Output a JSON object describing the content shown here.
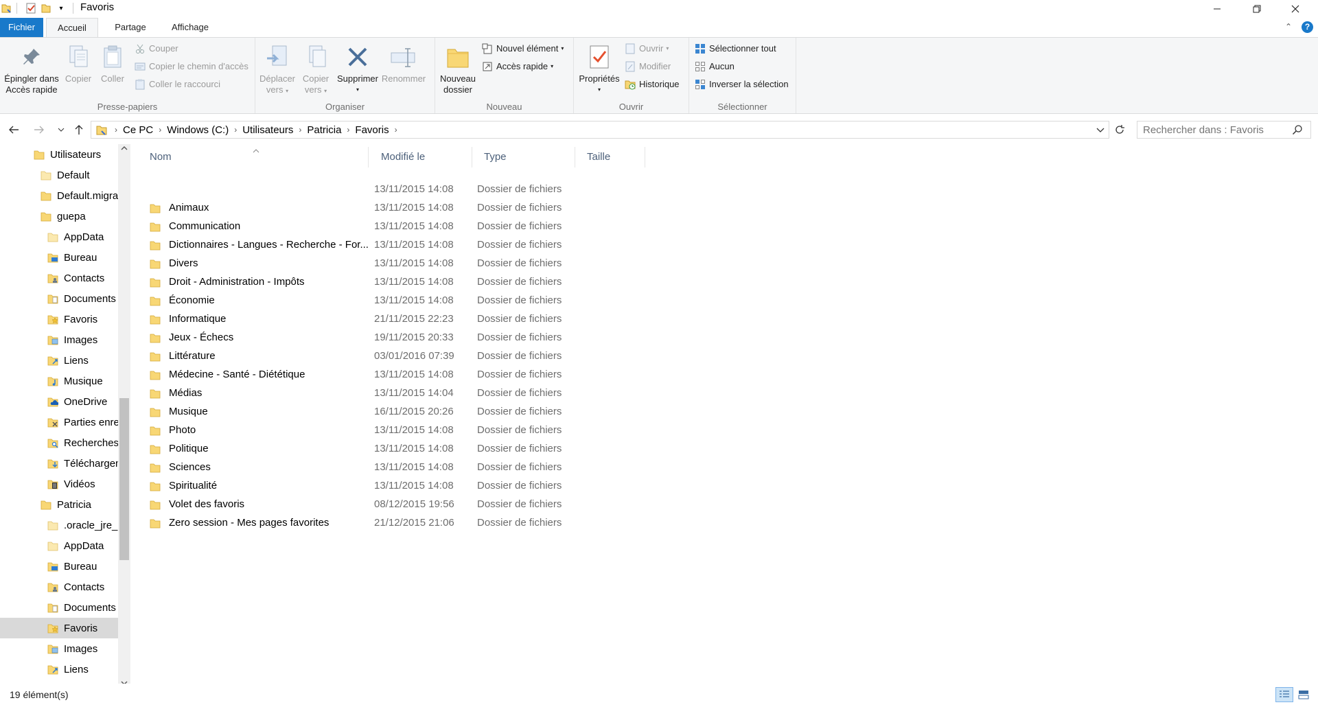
{
  "window": {
    "title": "Favoris"
  },
  "ribbon_tabs": [
    "Fichier",
    "Accueil",
    "Partage",
    "Affichage"
  ],
  "ribbon": {
    "presse_papiers": {
      "label": "Presse-papiers",
      "pin_line1": "Épingler dans",
      "pin_line2": "Accès rapide",
      "copy": "Copier",
      "paste": "Coller",
      "cut": "Couper",
      "copy_path": "Copier le chemin d'accès",
      "paste_shortcut": "Coller le raccourci"
    },
    "organiser": {
      "label": "Organiser",
      "move_line1": "Déplacer",
      "move_line2": "vers",
      "copyto_line1": "Copier",
      "copyto_line2": "vers",
      "delete": "Supprimer",
      "rename": "Renommer"
    },
    "nouveau": {
      "label": "Nouveau",
      "newfolder_line1": "Nouveau",
      "newfolder_line2": "dossier",
      "new_item": "Nouvel élément",
      "quick_access": "Accès rapide"
    },
    "ouvrir": {
      "label": "Ouvrir",
      "properties": "Propriétés",
      "open": "Ouvrir",
      "edit": "Modifier",
      "history": "Historique"
    },
    "selectionner": {
      "label": "Sélectionner",
      "select_all": "Sélectionner tout",
      "select_none": "Aucun",
      "invert": "Inverser la sélection"
    }
  },
  "address": {
    "crumbs": [
      "Ce PC",
      "Windows (C:)",
      "Utilisateurs",
      "Patricia",
      "Favoris"
    ]
  },
  "search": {
    "placeholder": "Rechercher dans : Favoris"
  },
  "nav_tree": [
    {
      "label": "Utilisateurs",
      "icon": "folder-icon"
    },
    {
      "label": "Default",
      "icon": "folder-light-icon"
    },
    {
      "label": "Default.migrated",
      "icon": "folder-icon"
    },
    {
      "label": "guepa",
      "icon": "folder-icon"
    },
    {
      "label": "AppData",
      "icon": "folder-light-icon"
    },
    {
      "label": "Bureau",
      "icon": "desktop-folder-icon"
    },
    {
      "label": "Contacts",
      "icon": "contacts-folder-icon"
    },
    {
      "label": "Documents",
      "icon": "documents-folder-icon"
    },
    {
      "label": "Favoris",
      "icon": "favorites-folder-icon"
    },
    {
      "label": "Images",
      "icon": "pictures-folder-icon"
    },
    {
      "label": "Liens",
      "icon": "links-folder-icon"
    },
    {
      "label": "Musique",
      "icon": "music-folder-icon"
    },
    {
      "label": "OneDrive",
      "icon": "onedrive-folder-icon"
    },
    {
      "label": "Parties enregistrées",
      "icon": "saved-games-folder-icon"
    },
    {
      "label": "Recherches",
      "icon": "searches-folder-icon"
    },
    {
      "label": "Téléchargements",
      "icon": "downloads-folder-icon"
    },
    {
      "label": "Vidéos",
      "icon": "videos-folder-icon"
    },
    {
      "label": "Patricia",
      "icon": "folder-icon"
    },
    {
      "label": ".oracle_jre_usage",
      "icon": "folder-light-icon"
    },
    {
      "label": "AppData",
      "icon": "folder-light-icon"
    },
    {
      "label": "Bureau",
      "icon": "desktop-folder-icon"
    },
    {
      "label": "Contacts",
      "icon": "contacts-folder-icon"
    },
    {
      "label": "Documents",
      "icon": "documents-folder-icon"
    },
    {
      "label": "Favoris",
      "icon": "favorites-folder-icon",
      "selected": true
    },
    {
      "label": "Images",
      "icon": "pictures-folder-icon"
    },
    {
      "label": "Liens",
      "icon": "links-folder-icon"
    }
  ],
  "columns": [
    "Nom",
    "Modifié le",
    "Type",
    "Taille"
  ],
  "files": [
    {
      "name": "",
      "date": "13/11/2015 14:08",
      "type": "Dossier de fichiers"
    },
    {
      "name": "Animaux",
      "date": "13/11/2015 14:08",
      "type": "Dossier de fichiers"
    },
    {
      "name": "Communication",
      "date": "13/11/2015 14:08",
      "type": "Dossier de fichiers"
    },
    {
      "name": "Dictionnaires - Langues - Recherche - For...",
      "date": "13/11/2015 14:08",
      "type": "Dossier de fichiers"
    },
    {
      "name": "Divers",
      "date": "13/11/2015 14:08",
      "type": "Dossier de fichiers"
    },
    {
      "name": "Droit - Administration - Impôts",
      "date": "13/11/2015 14:08",
      "type": "Dossier de fichiers"
    },
    {
      "name": "Économie",
      "date": "13/11/2015 14:08",
      "type": "Dossier de fichiers"
    },
    {
      "name": "Informatique",
      "date": "21/11/2015 22:23",
      "type": "Dossier de fichiers"
    },
    {
      "name": "Jeux - Échecs",
      "date": "19/11/2015 20:33",
      "type": "Dossier de fichiers"
    },
    {
      "name": "Littérature",
      "date": "03/01/2016 07:39",
      "type": "Dossier de fichiers"
    },
    {
      "name": "Médecine - Santé - Diététique",
      "date": "13/11/2015 14:08",
      "type": "Dossier de fichiers"
    },
    {
      "name": "Médias",
      "date": "13/11/2015 14:04",
      "type": "Dossier de fichiers"
    },
    {
      "name": "Musique",
      "date": "16/11/2015 20:26",
      "type": "Dossier de fichiers"
    },
    {
      "name": "Photo",
      "date": "13/11/2015 14:08",
      "type": "Dossier de fichiers"
    },
    {
      "name": "Politique",
      "date": "13/11/2015 14:08",
      "type": "Dossier de fichiers"
    },
    {
      "name": "Sciences",
      "date": "13/11/2015 14:08",
      "type": "Dossier de fichiers"
    },
    {
      "name": "Spiritualité",
      "date": "13/11/2015 14:08",
      "type": "Dossier de fichiers"
    },
    {
      "name": "Volet des favoris",
      "date": "08/12/2015 19:56",
      "type": "Dossier de fichiers"
    },
    {
      "name": "Zero session - Mes pages favorites",
      "date": "21/12/2015 21:06",
      "type": "Dossier de fichiers"
    }
  ],
  "status": {
    "count": "19 élément(s)"
  },
  "colors": {
    "accent": "#1979ca",
    "folder": "#f8d775",
    "folder_dark": "#e8b84a",
    "header_text": "#4c607a",
    "meta_text": "#6d6d6d"
  }
}
